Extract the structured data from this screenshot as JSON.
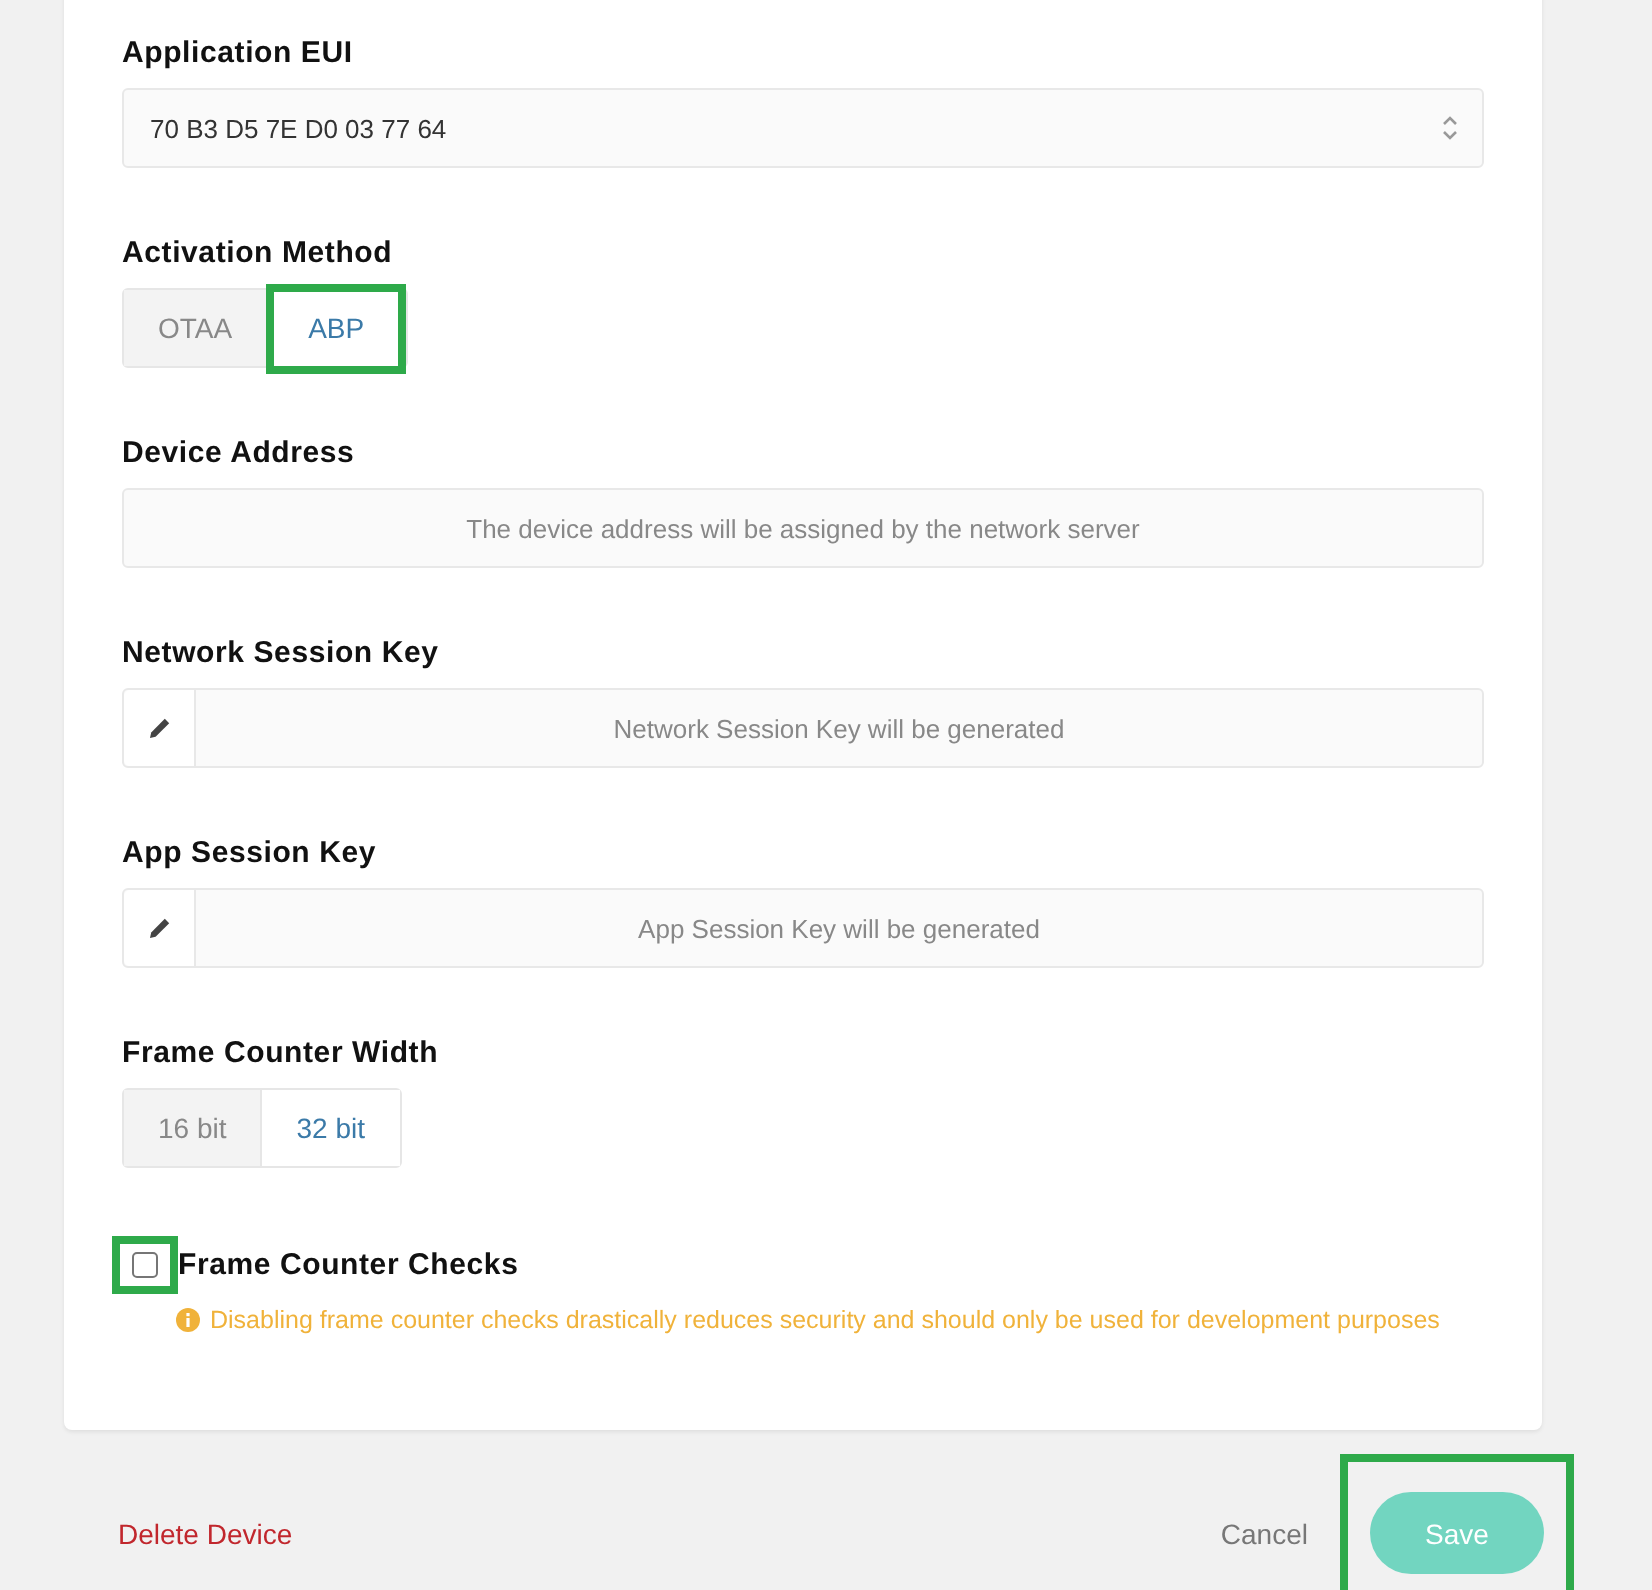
{
  "fields": [
    {
      "kind": "select",
      "label": "Application EUI",
      "value": "70 B3 D5 7E D0 03 77 64"
    },
    {
      "kind": "segmented",
      "label": "Activation Method",
      "options": [
        {
          "label": "OTAA",
          "selected": false,
          "highlighted": false
        },
        {
          "label": "ABP",
          "selected": true,
          "highlighted": true
        }
      ]
    },
    {
      "kind": "text",
      "label": "Device Address",
      "placeholder": "The device address will be assigned by the network server"
    },
    {
      "kind": "key",
      "label": "Network Session Key",
      "placeholder": "Network Session Key will be generated"
    },
    {
      "kind": "key",
      "label": "App Session Key",
      "placeholder": "App Session Key will be generated"
    },
    {
      "kind": "segmented",
      "label": "Frame Counter Width",
      "options": [
        {
          "label": "16 bit",
          "selected": false,
          "highlighted": false
        },
        {
          "label": "32 bit",
          "selected": true,
          "highlighted": false
        }
      ]
    },
    {
      "kind": "checkbox",
      "label": "Frame Counter Checks",
      "checked": false,
      "highlighted": true,
      "warning": "Disabling frame counter checks drastically reduces security and should only be used for development purposes"
    }
  ],
  "footer": {
    "delete": "Delete Device",
    "cancel": "Cancel",
    "save": {
      "label": "Save",
      "highlighted": true
    }
  }
}
